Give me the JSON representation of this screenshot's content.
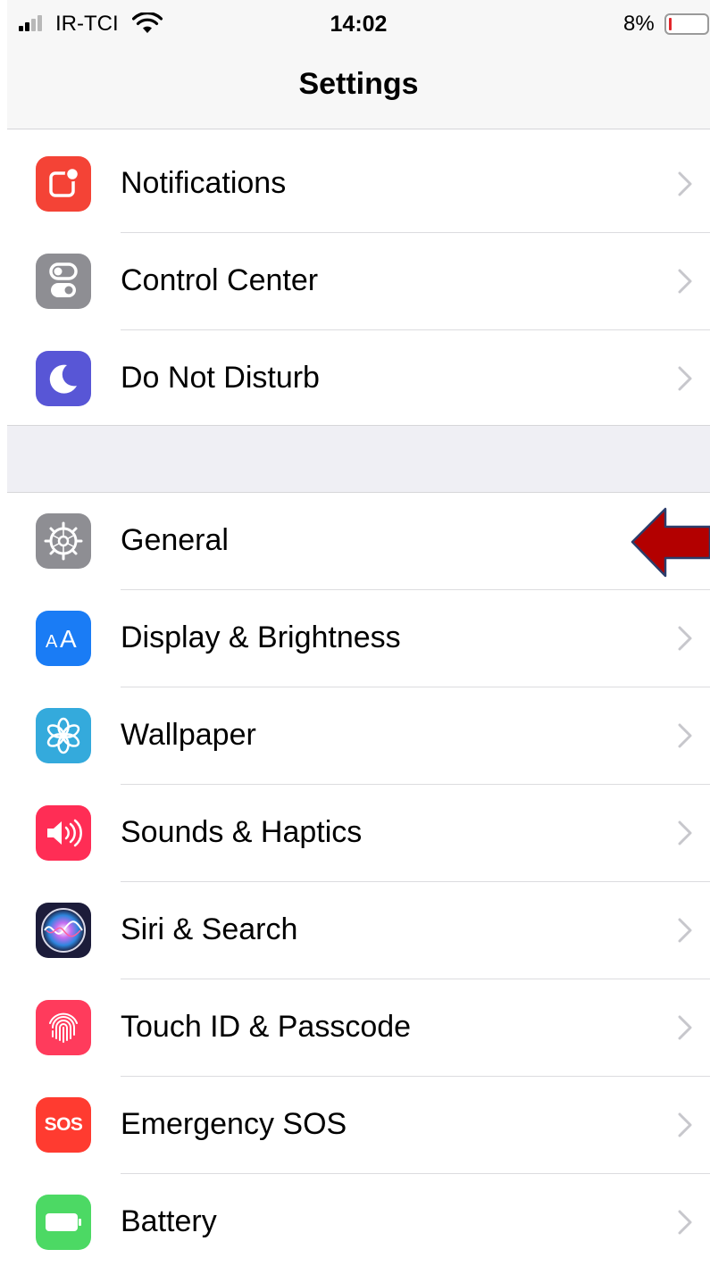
{
  "status_bar": {
    "carrier": "IR-TCI",
    "time": "14:02",
    "battery_percent": "8%",
    "battery_level": 0.08,
    "signal_bars_on": 2,
    "signal_bars_total": 4
  },
  "header": {
    "title": "Settings"
  },
  "groups": [
    {
      "items": [
        {
          "label": "Notifications",
          "icon": "notifications-icon",
          "color": "#f44336"
        },
        {
          "label": "Control Center",
          "icon": "control-center-icon",
          "color": "#8e8e93"
        },
        {
          "label": "Do Not Disturb",
          "icon": "moon-icon",
          "color": "#5856d6"
        }
      ]
    },
    {
      "items": [
        {
          "label": "General",
          "icon": "gear-icon",
          "color": "#8e8e93"
        },
        {
          "label": "Display & Brightness",
          "icon": "text-size-icon",
          "color": "#1a7cf5"
        },
        {
          "label": "Wallpaper",
          "icon": "flower-icon",
          "color": "#34aadc"
        },
        {
          "label": "Sounds & Haptics",
          "icon": "speaker-icon",
          "color": "#ff2d55"
        },
        {
          "label": "Siri & Search",
          "icon": "siri-icon",
          "color": "#1c1c3a"
        },
        {
          "label": "Touch ID & Passcode",
          "icon": "fingerprint-icon",
          "color": "#ff3b5c"
        },
        {
          "label": "Emergency SOS",
          "icon": "sos-icon",
          "color": "#ff3b30",
          "icon_text": "SOS"
        },
        {
          "label": "Battery",
          "icon": "battery-icon",
          "color": "#4cd964"
        }
      ]
    }
  ],
  "annotation": {
    "icon": "red-arrow-icon",
    "color": "#b30000",
    "points_to": "General"
  },
  "colors": {
    "nav_background": "#f7f7f7",
    "group_spacer": "#efeff4",
    "separator": "#dcdcdf",
    "chevron": "#c7c7cc"
  }
}
